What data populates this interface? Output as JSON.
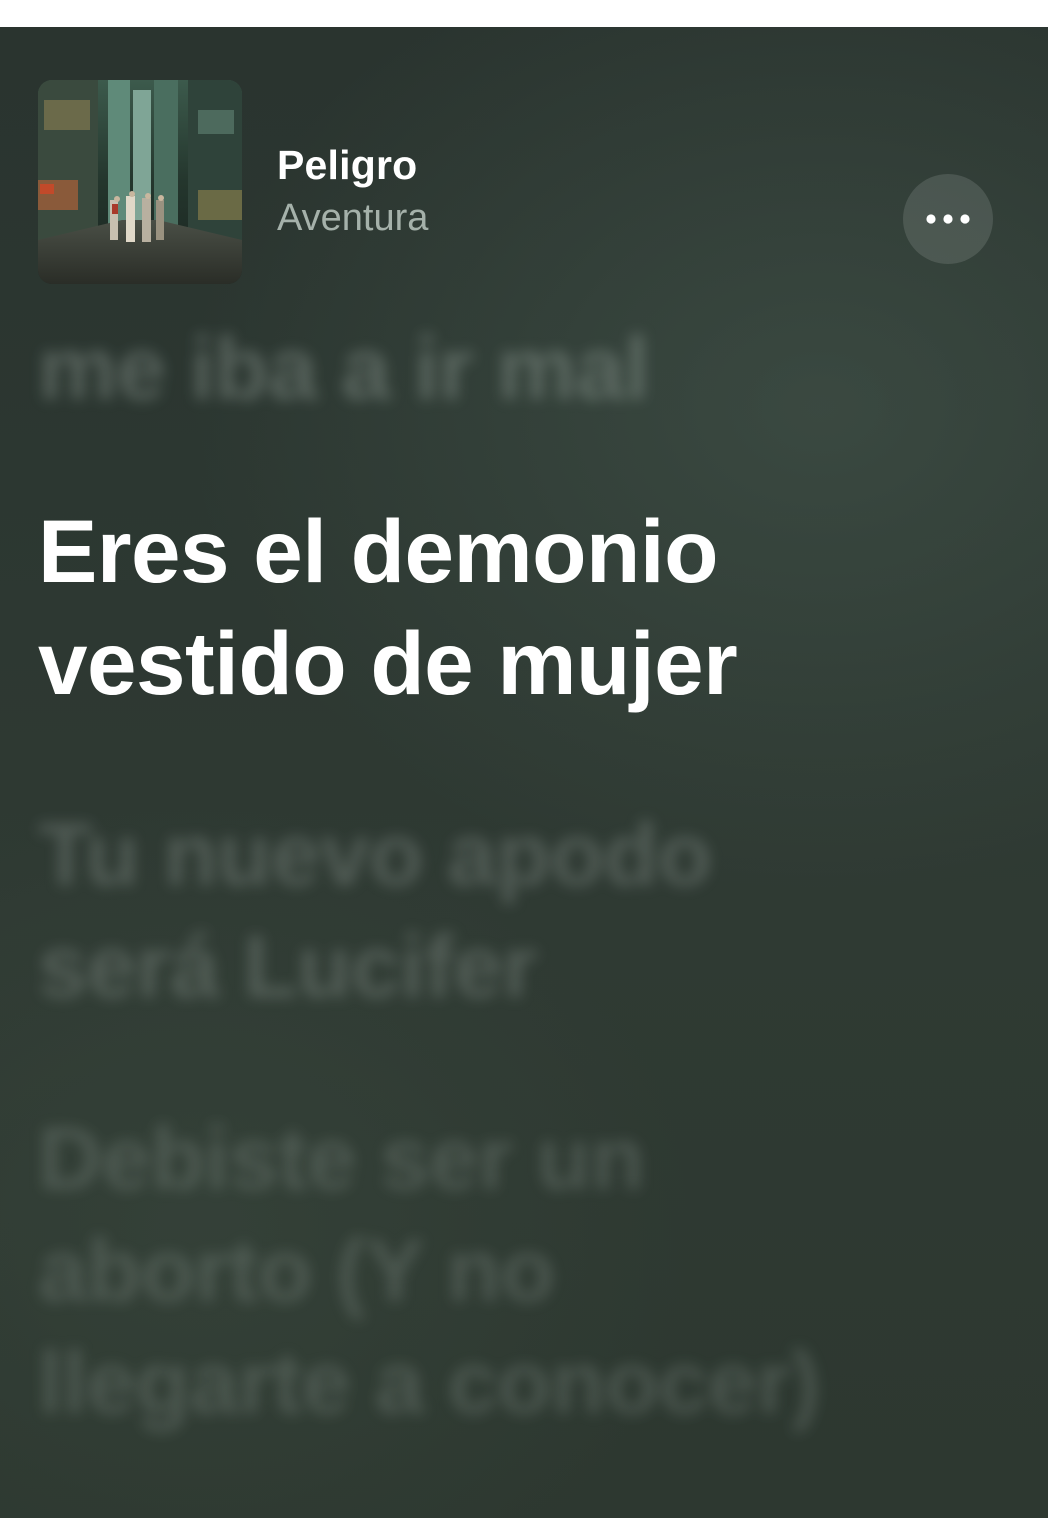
{
  "now_playing": {
    "title": "Peligro",
    "artist": "Aventura",
    "more_icon": "ellipsis-icon"
  },
  "lyrics": {
    "past": [
      "me iba a ir mal"
    ],
    "current": [
      "Eres el demonio",
      "vestido de mujer"
    ],
    "next_1": [
      "Tu nuevo apodo",
      "será Lucifer"
    ],
    "next_2": [
      "Debiste ser un",
      "aborto (Y no",
      "llegarte a conocer)"
    ]
  },
  "colors": {
    "background": "#2c3731",
    "title": "#ffffff",
    "artist": "#a5b1aa",
    "current_lyric": "#ffffff"
  }
}
